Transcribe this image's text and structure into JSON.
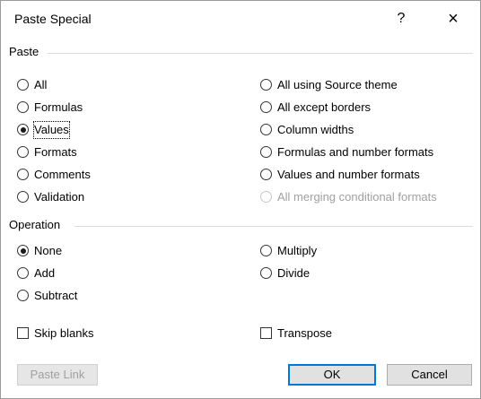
{
  "dialog": {
    "title": "Paste Special",
    "help_label": "?",
    "close_label": "×"
  },
  "paste": {
    "heading": "Paste",
    "left_options": [
      {
        "label": "All",
        "checked": false
      },
      {
        "label": "Formulas",
        "checked": false
      },
      {
        "label": "Values",
        "checked": true
      },
      {
        "label": "Formats",
        "checked": false
      },
      {
        "label": "Comments",
        "checked": false
      },
      {
        "label": "Validation",
        "checked": false
      }
    ],
    "right_options": [
      {
        "label": "All using Source theme",
        "enabled": true
      },
      {
        "label": "All except borders",
        "enabled": true
      },
      {
        "label": "Column widths",
        "enabled": true
      },
      {
        "label": "Formulas and number formats",
        "enabled": true
      },
      {
        "label": "Values and number formats",
        "enabled": true
      },
      {
        "label": "All merging conditional formats",
        "enabled": false
      }
    ]
  },
  "operation": {
    "heading": "Operation",
    "left_options": [
      {
        "label": "None",
        "checked": true
      },
      {
        "label": "Add",
        "checked": false
      },
      {
        "label": "Subtract",
        "checked": false
      }
    ],
    "right_options": [
      {
        "label": "Multiply",
        "checked": false
      },
      {
        "label": "Divide",
        "checked": false
      }
    ]
  },
  "checkboxes": {
    "skip_blanks": {
      "label": "Skip blanks",
      "checked": false
    },
    "transpose": {
      "label": "Transpose",
      "checked": false
    }
  },
  "buttons": {
    "paste_link": "Paste Link",
    "ok": "OK",
    "cancel": "Cancel"
  }
}
